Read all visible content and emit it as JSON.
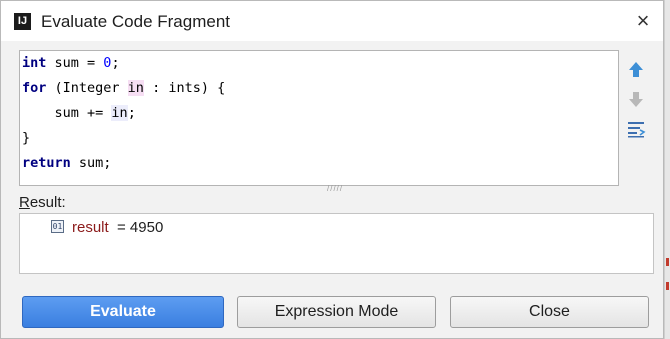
{
  "window": {
    "title": "Evaluate Code Fragment",
    "app_icon": "intellij-icon",
    "close_icon": "close-icon"
  },
  "editor": {
    "lines": [
      {
        "keyword": "int",
        "rest_a": " sum = ",
        "number": "0",
        "rest_b": ";"
      },
      {
        "keyword": "for",
        "rest_a": " (Integer ",
        "hl_word": "in",
        "rest_b": " : ints) {"
      },
      {
        "indent": "    ",
        "rest_a": "sum += ",
        "hl_word": "in",
        "rest_b": ";"
      },
      {
        "rest_a": "}"
      },
      {
        "keyword": "return",
        "rest_a": " sum;"
      }
    ],
    "grip": "/////"
  },
  "tools": {
    "up_icon": "arrow-up-icon",
    "down_icon": "arrow-down-icon",
    "history_icon": "history-icon"
  },
  "result": {
    "label_first": "R",
    "label_rest": "esult:",
    "icon": "primitive-value-icon",
    "icon_glyph": "01",
    "name": "result",
    "equals_value": "= 4950"
  },
  "buttons": {
    "evaluate": "Evaluate",
    "expression_mode": "Expression Mode",
    "close": "Close"
  },
  "colors": {
    "keyword": "#000080",
    "number": "#0000ff",
    "primary_button": "#3a7fe0",
    "highlight_pink": "#f6def3",
    "highlight_lavender": "#ecedfb"
  }
}
